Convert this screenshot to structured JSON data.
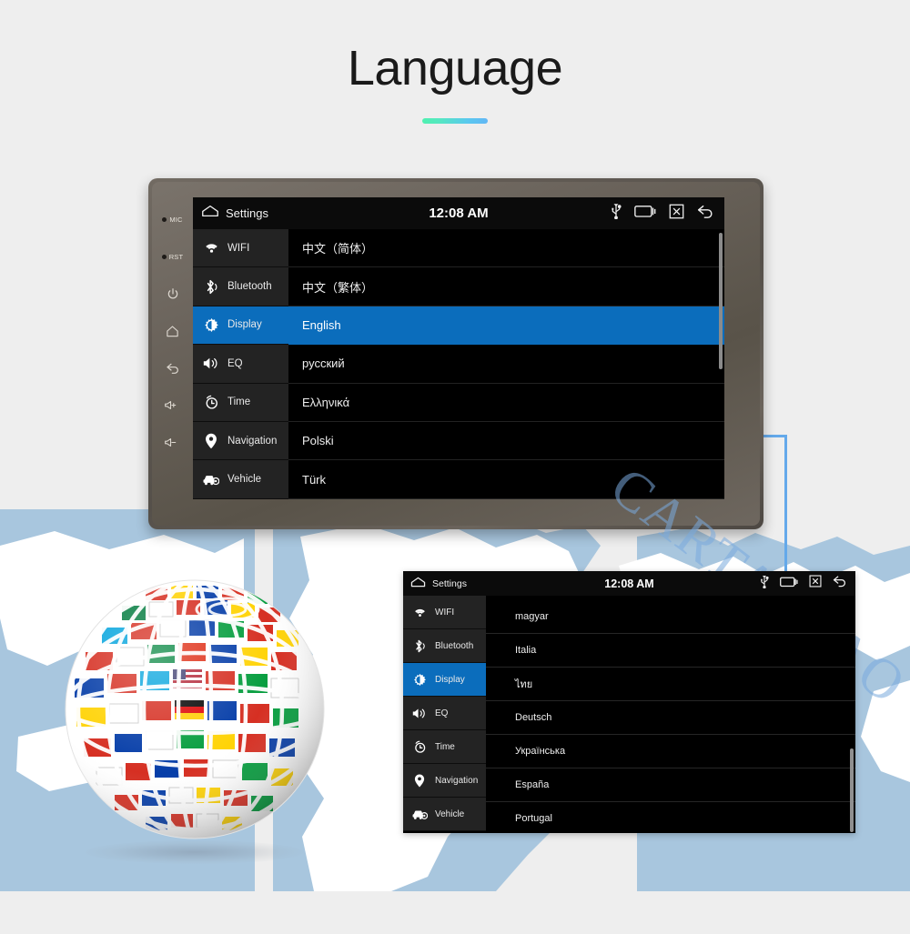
{
  "page": {
    "title": "Language",
    "background_color": "#eeeeee",
    "accent_gradient_start": "#4ff0b0",
    "accent_gradient_end": "#62b7f5"
  },
  "watermark": {
    "text": "CARTAOTAO",
    "color": "#7aaade"
  },
  "connector": {
    "color": "#64a9ea"
  },
  "device": {
    "bezel_labels": {
      "mic": "MIC",
      "rst": "RST"
    },
    "bezel_buttons": [
      {
        "name": "mic-indicator",
        "label": "MIC"
      },
      {
        "name": "reset-indicator",
        "label": "RST"
      },
      {
        "name": "power-button",
        "glyph": "⏻"
      },
      {
        "name": "home-button",
        "glyph": "⌂"
      },
      {
        "name": "back-button",
        "glyph": "↶"
      },
      {
        "name": "volume-up-button",
        "glyph": "◁+"
      },
      {
        "name": "volume-down-button",
        "glyph": "◁-"
      }
    ]
  },
  "screen_main": {
    "topbar": {
      "home_icon": "home-icon",
      "title": "Settings",
      "clock": "12:08 AM",
      "status_icons": [
        "usb-icon",
        "recents-icon",
        "close-icon",
        "back-icon"
      ]
    },
    "sidebar": {
      "items": [
        {
          "label": "WIFI",
          "icon": "wifi-icon",
          "active": false
        },
        {
          "label": "Bluetooth",
          "icon": "bluetooth-icon",
          "active": false
        },
        {
          "label": "Display",
          "icon": "brightness-icon",
          "active": true
        },
        {
          "label": "EQ",
          "icon": "speaker-icon",
          "active": false
        },
        {
          "label": "Time",
          "icon": "alarm-clock-icon",
          "active": false
        },
        {
          "label": "Navigation",
          "icon": "map-pin-icon",
          "active": false
        },
        {
          "label": "Vehicle",
          "icon": "car-icon",
          "active": false
        }
      ]
    },
    "languages": [
      {
        "label": "中文（简体）",
        "selected": false
      },
      {
        "label": "中文（繁体）",
        "selected": false
      },
      {
        "label": "English",
        "selected": true
      },
      {
        "label": "русский",
        "selected": false
      },
      {
        "label": "Ελληνικά",
        "selected": false
      },
      {
        "label": "Polski",
        "selected": false
      },
      {
        "label": "Türk",
        "selected": false
      }
    ],
    "selected_color": "#0b6dbc"
  },
  "screen_second": {
    "topbar": {
      "home_icon": "home-icon",
      "title": "Settings",
      "clock": "12:08 AM",
      "status_icons": [
        "usb-icon",
        "recents-icon",
        "close-icon",
        "back-icon"
      ]
    },
    "sidebar": {
      "items": [
        {
          "label": "WIFI",
          "icon": "wifi-icon",
          "active": false
        },
        {
          "label": "Bluetooth",
          "icon": "bluetooth-icon",
          "active": false
        },
        {
          "label": "Display",
          "icon": "brightness-icon",
          "active": true
        },
        {
          "label": "EQ",
          "icon": "speaker-icon",
          "active": false
        },
        {
          "label": "Time",
          "icon": "alarm-clock-icon",
          "active": false
        },
        {
          "label": "Navigation",
          "icon": "map-pin-icon",
          "active": false
        },
        {
          "label": "Vehicle",
          "icon": "car-icon",
          "active": false
        }
      ]
    },
    "languages": [
      {
        "label": "magyar"
      },
      {
        "label": "Italia"
      },
      {
        "label": "ไทย"
      },
      {
        "label": "Deutsch"
      },
      {
        "label": "Українська"
      },
      {
        "label": "España"
      },
      {
        "label": "Portugal"
      }
    ]
  },
  "globe": {
    "name": "flags-globe-image",
    "alt": "Globe made of world flags"
  }
}
